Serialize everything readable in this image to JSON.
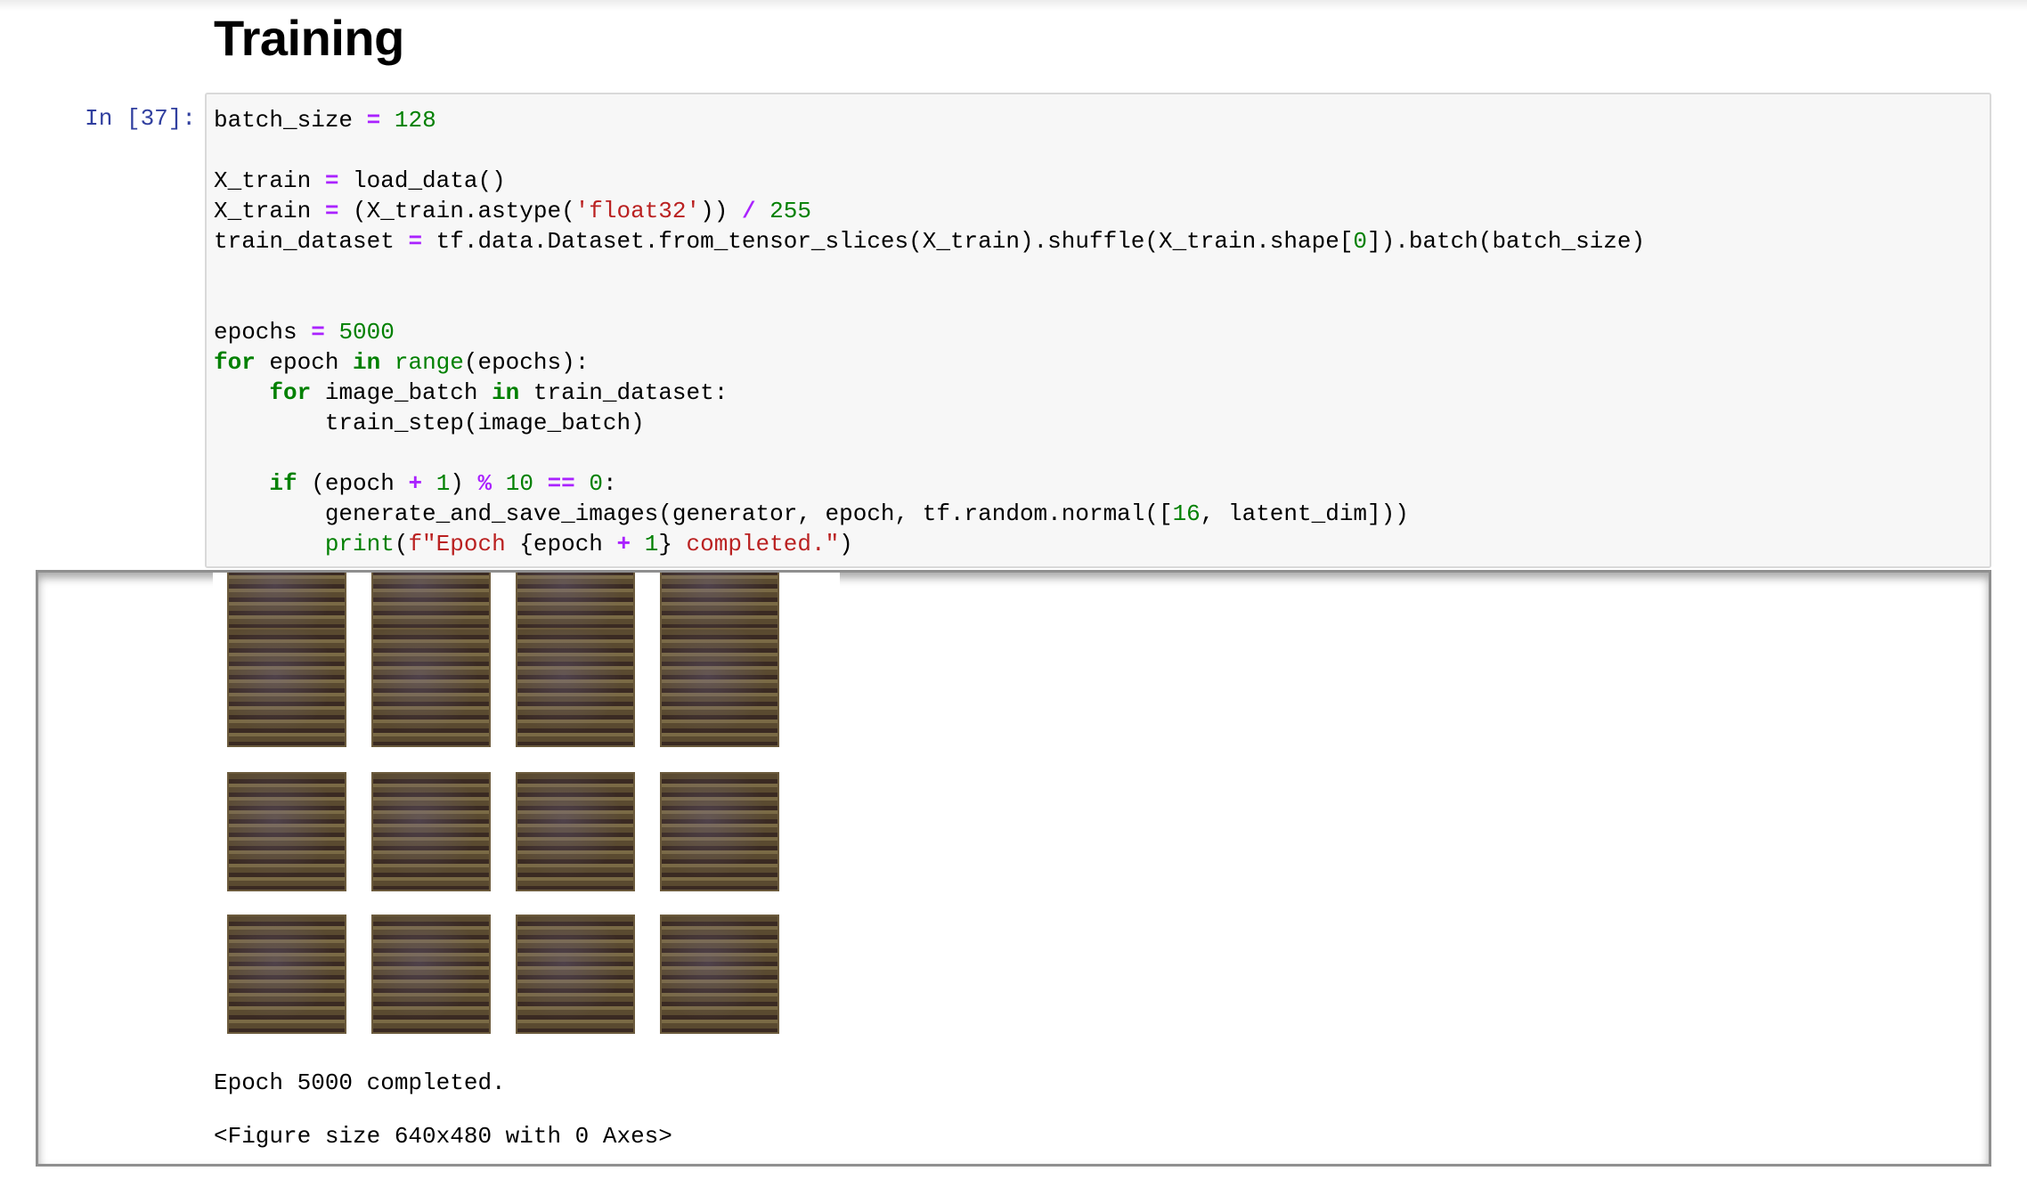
{
  "notebook": {
    "heading": "Training",
    "cell": {
      "prompt": "In [37]:",
      "code_lines": [
        [
          {
            "t": "batch_size "
          },
          {
            "t": "=",
            "c": "op"
          },
          {
            "t": " "
          },
          {
            "t": "128",
            "c": "num"
          }
        ],
        [],
        [
          {
            "t": "X_train "
          },
          {
            "t": "=",
            "c": "op"
          },
          {
            "t": " load_data()"
          }
        ],
        [
          {
            "t": "X_train "
          },
          {
            "t": "=",
            "c": "op"
          },
          {
            "t": " (X_train.astype("
          },
          {
            "t": "'float32'",
            "c": "str"
          },
          {
            "t": ")) "
          },
          {
            "t": "/",
            "c": "op"
          },
          {
            "t": " "
          },
          {
            "t": "255",
            "c": "num"
          }
        ],
        [
          {
            "t": "train_dataset "
          },
          {
            "t": "=",
            "c": "op"
          },
          {
            "t": " tf.data.Dataset.from_tensor_slices(X_train).shuffle(X_train.shape["
          },
          {
            "t": "0",
            "c": "num"
          },
          {
            "t": "]).batch(batch_size)"
          }
        ],
        [],
        [],
        [
          {
            "t": "epochs "
          },
          {
            "t": "=",
            "c": "op"
          },
          {
            "t": " "
          },
          {
            "t": "5000",
            "c": "num"
          }
        ],
        [
          {
            "t": "for",
            "c": "kw"
          },
          {
            "t": " epoch "
          },
          {
            "t": "in",
            "c": "kw"
          },
          {
            "t": " "
          },
          {
            "t": "range",
            "c": "bi"
          },
          {
            "t": "(epochs):"
          }
        ],
        [
          {
            "t": "    "
          },
          {
            "t": "for",
            "c": "kw"
          },
          {
            "t": " image_batch "
          },
          {
            "t": "in",
            "c": "kw"
          },
          {
            "t": " train_dataset:"
          }
        ],
        [
          {
            "t": "        train_step(image_batch)"
          }
        ],
        [],
        [
          {
            "t": "    "
          },
          {
            "t": "if",
            "c": "kw"
          },
          {
            "t": " (epoch "
          },
          {
            "t": "+",
            "c": "op"
          },
          {
            "t": " "
          },
          {
            "t": "1",
            "c": "num"
          },
          {
            "t": ") "
          },
          {
            "t": "%",
            "c": "op"
          },
          {
            "t": " "
          },
          {
            "t": "10",
            "c": "num"
          },
          {
            "t": " "
          },
          {
            "t": "==",
            "c": "op"
          },
          {
            "t": " "
          },
          {
            "t": "0",
            "c": "num"
          },
          {
            "t": ":"
          }
        ],
        [
          {
            "t": "        generate_and_save_images(generator, epoch, tf.random.normal(["
          },
          {
            "t": "16",
            "c": "num"
          },
          {
            "t": ", latent_dim]))"
          }
        ],
        [
          {
            "t": "        "
          },
          {
            "t": "print",
            "c": "bi"
          },
          {
            "t": "("
          },
          {
            "t": "f\"Epoch ",
            "c": "str"
          },
          {
            "t": "{epoch "
          },
          {
            "t": "+",
            "c": "op"
          },
          {
            "t": " "
          },
          {
            "t": "1",
            "c": "num"
          },
          {
            "t": "}"
          },
          {
            "t": " completed.\"",
            "c": "str"
          },
          {
            "t": ")"
          }
        ]
      ]
    },
    "output": {
      "grid": {
        "rows": 4,
        "cols": 4,
        "partial_top_row": true
      },
      "epoch_line": "Epoch 5000 completed.",
      "figure_line": "<Figure size 640x480 with 0 Axes>"
    }
  }
}
